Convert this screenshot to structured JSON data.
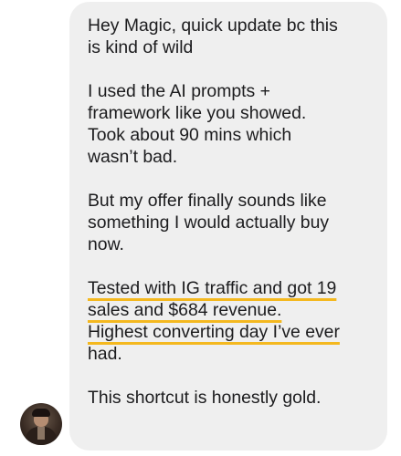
{
  "message": {
    "p1": "Hey Magic, quick update bc this\nis kind of wild",
    "p2": "I used the AI prompts +\nframework like you showed.\nTook about 90 mins which\nwasn’t bad.",
    "p3": "But my offer finally sounds like\nsomething I would actually buy\nnow.",
    "p4_lines": [
      "Tested with IG traffic and got 19",
      "sales and $684 revenue.",
      "Highest converting day I’ve ever",
      "had."
    ],
    "p5": "This shortcut is honestly gold."
  },
  "colors": {
    "bubble": "#efefef",
    "text": "#1c1c1e",
    "highlight_underline": "#f4b81f"
  }
}
